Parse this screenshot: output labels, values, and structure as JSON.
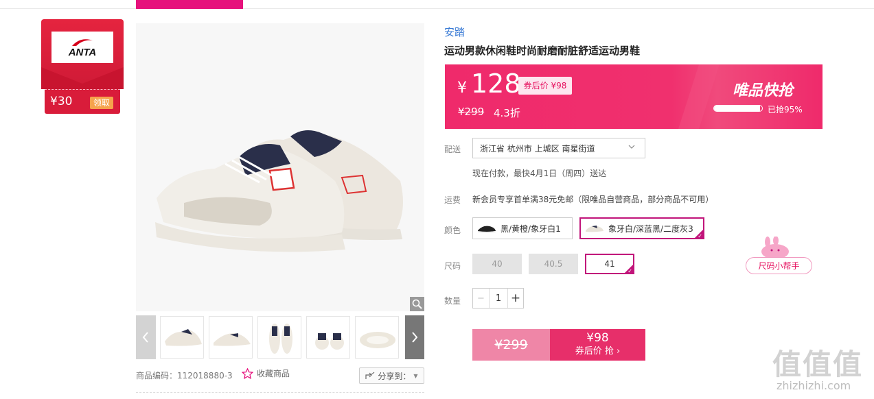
{
  "coupon": {
    "brand_logo": "ANTA",
    "amount": "¥30",
    "claim_label": "领取"
  },
  "product": {
    "brand": "安踏",
    "title": "运动男款休闲鞋时尚耐磨耐脏舒适运动男鞋",
    "sku": "商品编码：112018880-3",
    "favorite_label": "收藏商品",
    "share_label": "分享到："
  },
  "price": {
    "currency": "¥",
    "current": "128",
    "after_coupon_tag": "券后价 ¥98",
    "original": "¥299",
    "discount": "4.3折",
    "flash_title": "唯品快抢",
    "grabbed_percent": 95,
    "grabbed_label": "已抢95%"
  },
  "delivery": {
    "label": "配送",
    "address": "浙江省 杭州市 上城区 南星街道",
    "note": "现在付款，最快4月1日（周四）送达"
  },
  "shipping": {
    "label": "运费",
    "text": "新会员专享首单满38元免邮（限唯品自营商品，部分商品不可用）"
  },
  "color": {
    "label": "颜色",
    "options": [
      {
        "name": "黑/黄橙/象牙白1",
        "selected": false
      },
      {
        "name": "象牙白/深蓝黑/二度灰3",
        "selected": true
      }
    ]
  },
  "size": {
    "label": "尺码",
    "options": [
      {
        "value": "40",
        "selected": false
      },
      {
        "value": "40.5",
        "selected": false
      },
      {
        "value": "41",
        "selected": true
      }
    ],
    "helper_label": "尺码小帮手"
  },
  "quantity": {
    "label": "数量",
    "minus": "−",
    "value": "1",
    "plus": "+"
  },
  "buy": {
    "original": "¥299",
    "after_price": "¥98",
    "after_label": "券后价 抢 ›"
  },
  "watermark": {
    "text": "值值值",
    "url": "zhizhizhi.com"
  },
  "colors": {
    "accent": "#e6117c",
    "price_bg": "#ef2a6b",
    "coupon_red": "#d91c3a",
    "brand_blue": "#3a7bd5",
    "selected_border": "#c1147a"
  }
}
